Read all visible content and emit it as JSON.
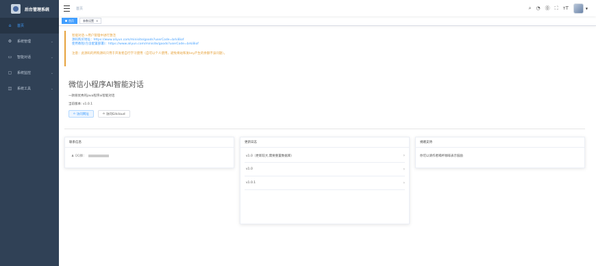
{
  "brand": {
    "title": "后台管理系统"
  },
  "sidebar": {
    "items": [
      {
        "label": "首页",
        "icon": "home-icon",
        "glyph": "⌂"
      },
      {
        "label": "系统管理",
        "icon": "gear-icon",
        "glyph": "⚙"
      },
      {
        "label": "智能对话",
        "icon": "chat-icon",
        "glyph": "▭"
      },
      {
        "label": "系统监控",
        "icon": "monitor-icon",
        "glyph": "▢"
      },
      {
        "label": "系统工具",
        "icon": "tool-icon",
        "glyph": "◫"
      }
    ]
  },
  "navbar": {
    "breadcrumb": "首页"
  },
  "tags": [
    {
      "label": "首页",
      "active": true
    },
    {
      "label": "参数设置",
      "active": false
    }
  ],
  "notice": {
    "line1": "智能对话->用户管理中进行激活",
    "line2": "源码购买地址：https://www.aliyun.com/minisite/goods?userCode=brki8iof",
    "line3": "使用教程(包含配置部署)：https://www.aliyun.com/minisite/goods?userCode=brki8iof",
    "warning": "注意：此源码的所购源码只用于开发者自行学习使用（自可以个人使用，避免将站和发key产生的余额不该问题）。"
  },
  "hero": {
    "title": "微信小程序AI智能对话",
    "description": "一款很优秀的java程序ai智能对话",
    "version": "当前版本: v1.0.1",
    "primary_button": "访问网址",
    "secondary_button": "访问Gitcloud"
  },
  "cards": {
    "contact": {
      "title": "联系信息",
      "line": "QQ群："
    },
    "changelog": {
      "title": "更新日志",
      "items": [
        "v1.0（更新较大,需要重置数据库）",
        "v1.0",
        "v1.0.1"
      ]
    },
    "support": {
      "title": "捐赠支持",
      "text": "你可以请作者喝杯咖啡表示鼓励"
    }
  },
  "colors": {
    "sidebar": "#304156",
    "accent": "#409eff",
    "warning": "#e6a23c"
  }
}
